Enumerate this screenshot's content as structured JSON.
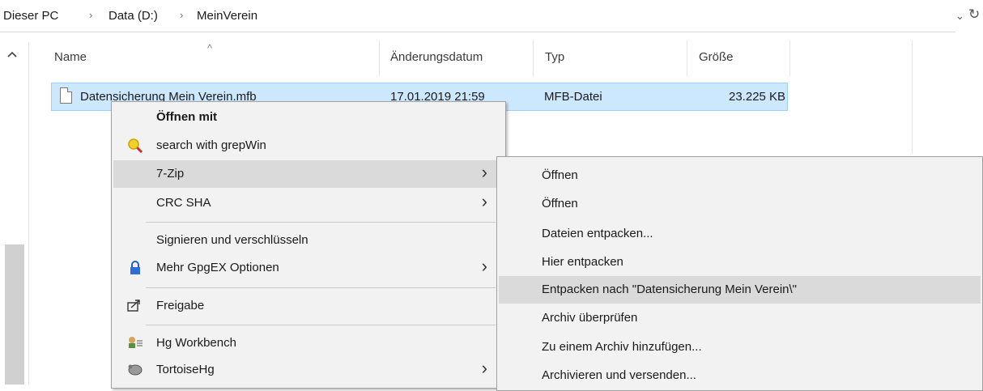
{
  "breadcrumb": {
    "items": [
      "Dieser PC",
      "Data (D:)",
      "MeinVerein"
    ],
    "separator": "›"
  },
  "address_controls": {
    "dropdown_glyph": "⌄",
    "refresh_glyph": "↻"
  },
  "columns": {
    "name": "Name",
    "date": "Änderungsdatum",
    "type": "Typ",
    "size": "Größe",
    "sort_indicator": "^"
  },
  "file": {
    "name": "Datensicherung Mein Verein.mfb",
    "date": "17.01.2019 21:59",
    "type": "MFB-Datei",
    "size": "23.225 KB"
  },
  "context_menu": {
    "items": [
      {
        "label": "Öffnen mit",
        "bold": true
      },
      {
        "label": "search with grepWin",
        "icon": "magnifier-icon"
      },
      {
        "label": "7-Zip",
        "has_submenu": true,
        "highlighted": true
      },
      {
        "label": "CRC SHA",
        "has_submenu": true
      },
      {
        "label": "Signieren und verschlüsseln"
      },
      {
        "label": "Mehr GpgEX Optionen",
        "has_submenu": true,
        "icon": "lock-icon"
      },
      {
        "label": "Freigabe",
        "icon": "share-icon"
      },
      {
        "label": "Hg Workbench",
        "icon": "hg-workbench-icon"
      },
      {
        "label": "TortoiseHg",
        "has_submenu": true,
        "icon": "tortoisehg-icon"
      }
    ],
    "chevron": "›"
  },
  "submenu_7zip": {
    "items": [
      "Öffnen",
      "Öffnen",
      "Dateien entpacken...",
      "Hier entpacken",
      "Entpacken nach \"Datensicherung Mein Verein\\\"",
      "Archiv überprüfen",
      "Zu einem Archiv hinzufügen...",
      "Archivieren und versenden..."
    ],
    "highlighted_index": 4
  },
  "colors": {
    "selection_bg": "#cce8ff",
    "selection_border": "#99d1ff",
    "menu_bg": "#f2f2f2",
    "menu_highlight": "#dadada"
  }
}
